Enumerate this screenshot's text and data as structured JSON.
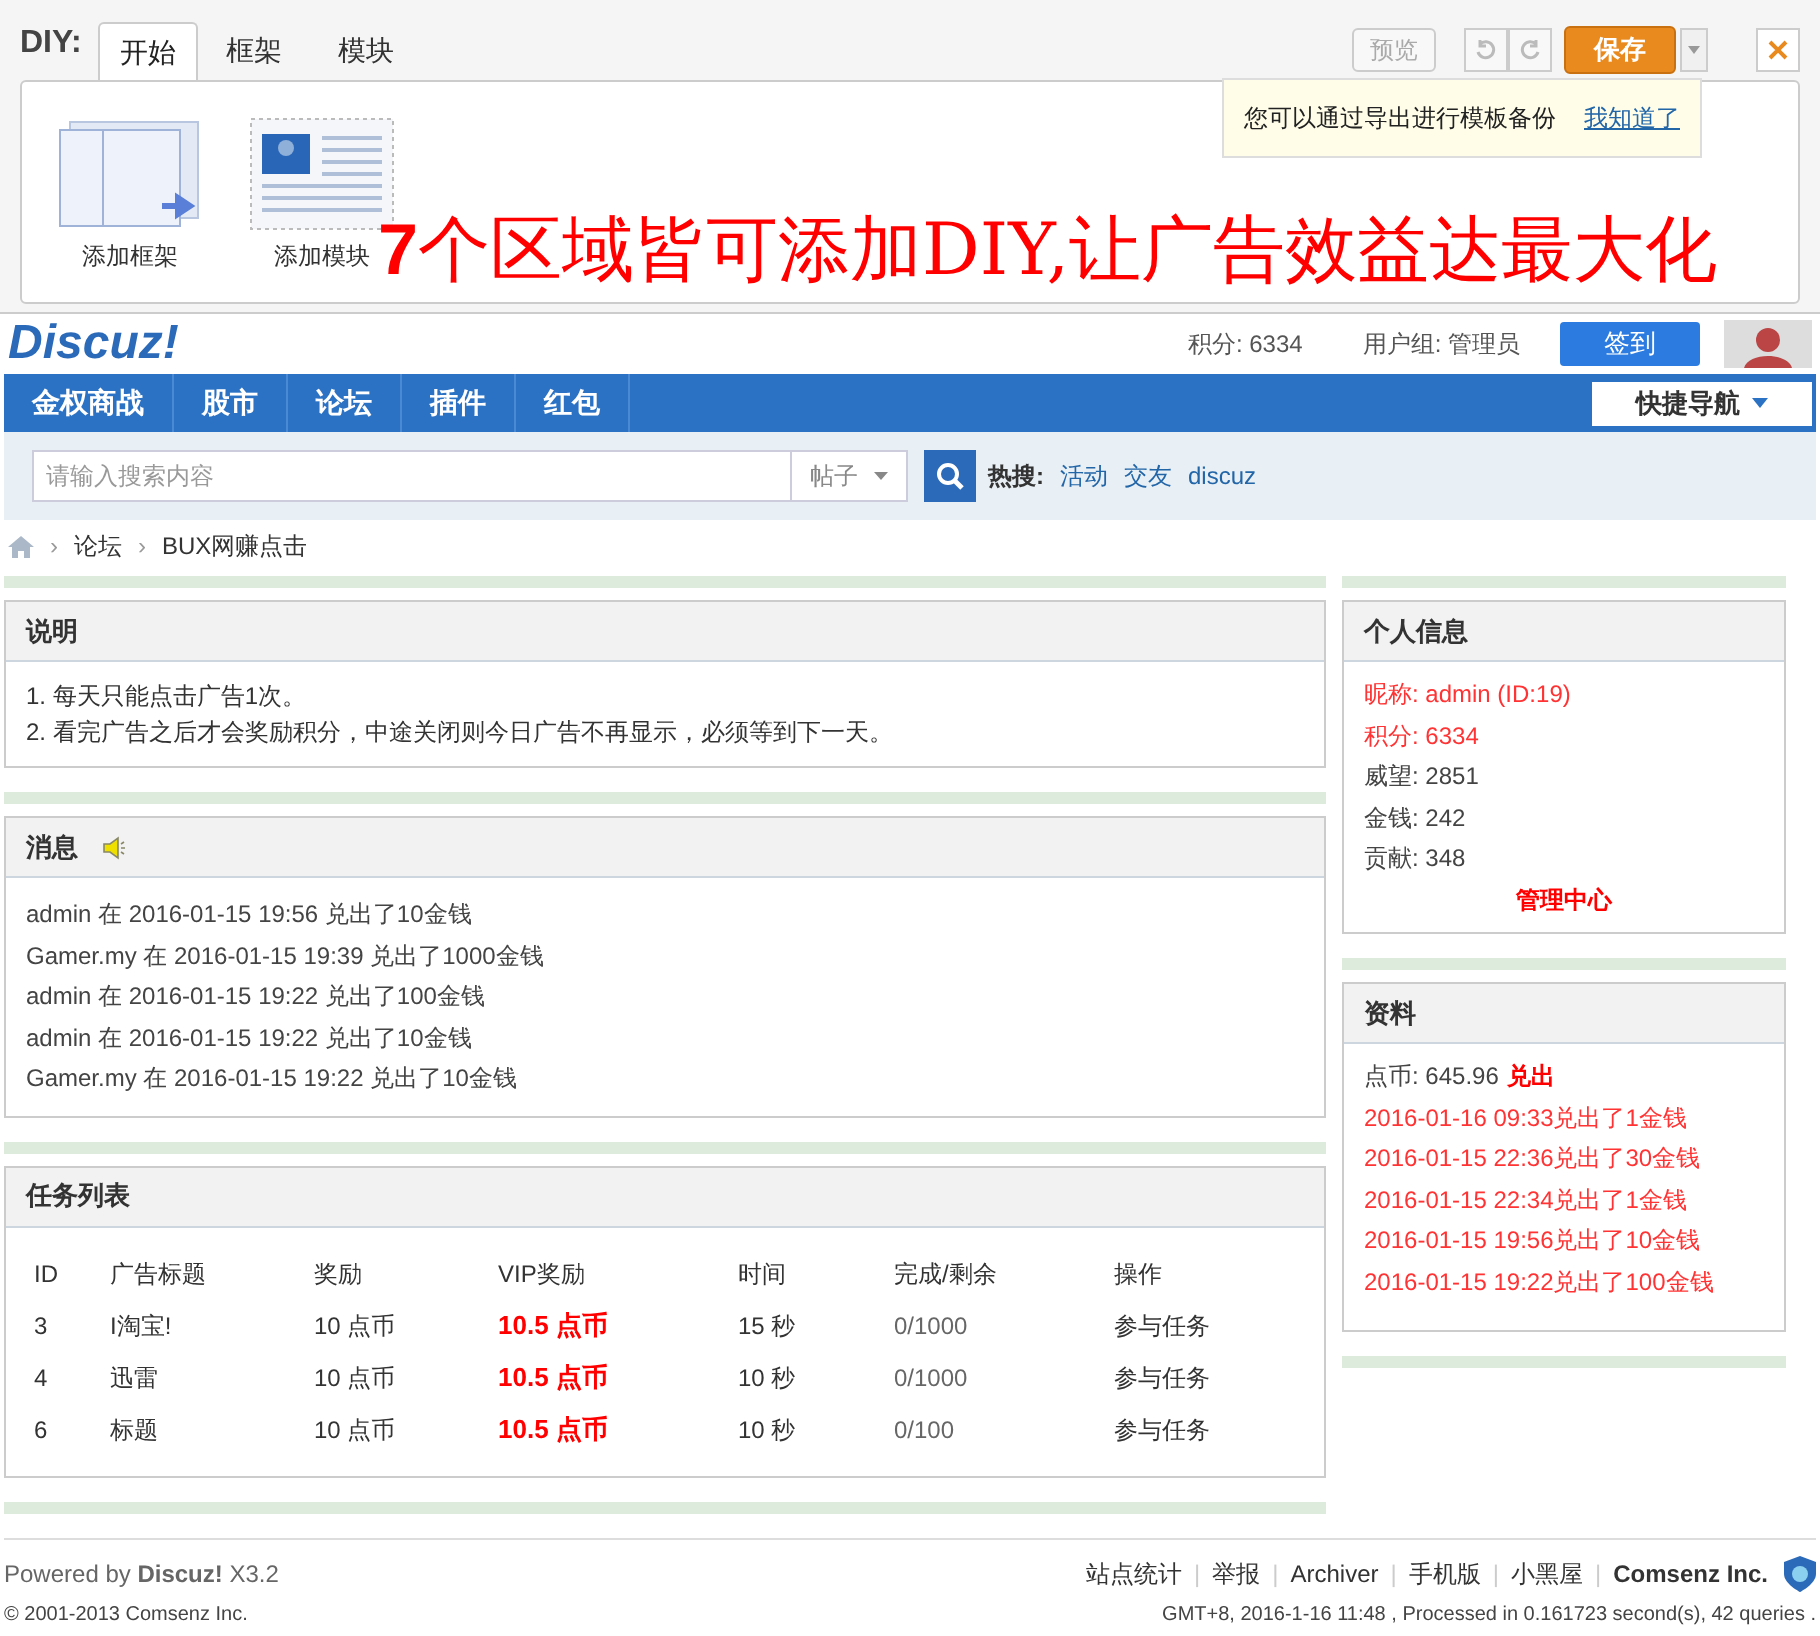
{
  "diy": {
    "label": "DIY:",
    "tabs": [
      {
        "label": "开始",
        "selected": true
      },
      {
        "label": "框架",
        "selected": false
      },
      {
        "label": "模块",
        "selected": false
      }
    ],
    "preview": "预览",
    "save": "保存",
    "tip": {
      "text": "您可以通过导出进行模板备份",
      "link": "我知道了"
    },
    "tools": [
      {
        "kind": "frame",
        "label": "添加框架"
      },
      {
        "kind": "module",
        "label": "添加模块"
      }
    ],
    "annotation": "7个区域皆可添加DIY,让广告效益达最大化"
  },
  "header": {
    "logo": "Discuz!",
    "points": "积分: 6334",
    "group": "用户组: 管理员",
    "checkin": "签到"
  },
  "nav": {
    "items": [
      "金权商战",
      "股市",
      "论坛",
      "插件",
      "红包"
    ],
    "quick": "快捷导航"
  },
  "search": {
    "placeholder": "请输入搜索内容",
    "type": "帖子",
    "hot_label": "热搜:",
    "hot": [
      "活动",
      "交友",
      "discuz"
    ]
  },
  "breadcrumb": {
    "separator": "›",
    "items": [
      "论坛",
      "BUX网赚点击"
    ]
  },
  "notes": {
    "title": "说明",
    "lines": [
      "1. 每天只能点击广告1次。",
      "2. 看完广告之后才会奖励积分，中途关闭则今日广告不再显示，必须等到下一天。"
    ]
  },
  "messages": {
    "title": "消息",
    "lines": [
      "admin 在 2016-01-15 19:56 兑出了10金钱",
      "Gamer.my 在 2016-01-15 19:39 兑出了1000金钱",
      "admin 在 2016-01-15 19:22 兑出了100金钱",
      "admin 在 2016-01-15 19:22 兑出了10金钱",
      "Gamer.my 在 2016-01-15 19:22 兑出了10金钱"
    ]
  },
  "tasks": {
    "title": "任务列表",
    "columns": [
      "ID",
      "广告标题",
      "奖励",
      "VIP奖励",
      "时间",
      "完成/剩余",
      "操作"
    ],
    "rows": [
      [
        "3",
        "I淘宝!",
        "10 点币",
        "10.5 点币",
        "15 秒",
        "0/1000",
        "参与任务"
      ],
      [
        "4",
        "迅雷",
        "10 点币",
        "10.5 点币",
        "10 秒",
        "0/1000",
        "参与任务"
      ],
      [
        "6",
        "标题",
        "10 点币",
        "10.5 点币",
        "10 秒",
        "0/100",
        "参与任务"
      ]
    ]
  },
  "profile": {
    "title": "个人信息",
    "lines": [
      {
        "text": "昵称: admin (ID:19)",
        "highlight": true
      },
      {
        "text": "积分: 6334",
        "highlight": true
      },
      {
        "text": "威望: 2851",
        "highlight": false
      },
      {
        "text": "金钱: 242",
        "highlight": false
      },
      {
        "text": "贡献: 348",
        "highlight": false
      }
    ],
    "link": "管理中心"
  },
  "records": {
    "title": "资料",
    "balance": "点币: 645.96",
    "action": "兑出",
    "lines": [
      "2016-01-16 09:33兑出了1金钱",
      "2016-01-15 22:36兑出了30金钱",
      "2016-01-15 22:34兑出了1金钱",
      "2016-01-15 19:56兑出了10金钱",
      "2016-01-15 19:22兑出了100金钱"
    ]
  },
  "footer": {
    "powered": "Powered by **Discuz!** X3.2",
    "copyright": "© 2001-2013 Comsenz Inc.",
    "separator": "|",
    "links": [
      "站点统计",
      "举报",
      "Archiver",
      "手机版",
      "小黑屋"
    ],
    "company": "Comsenz Inc.",
    "stats": "GMT+8, 2016-1-16 11:48 , Processed in 0.161723 second(s), 42 queries ."
  }
}
